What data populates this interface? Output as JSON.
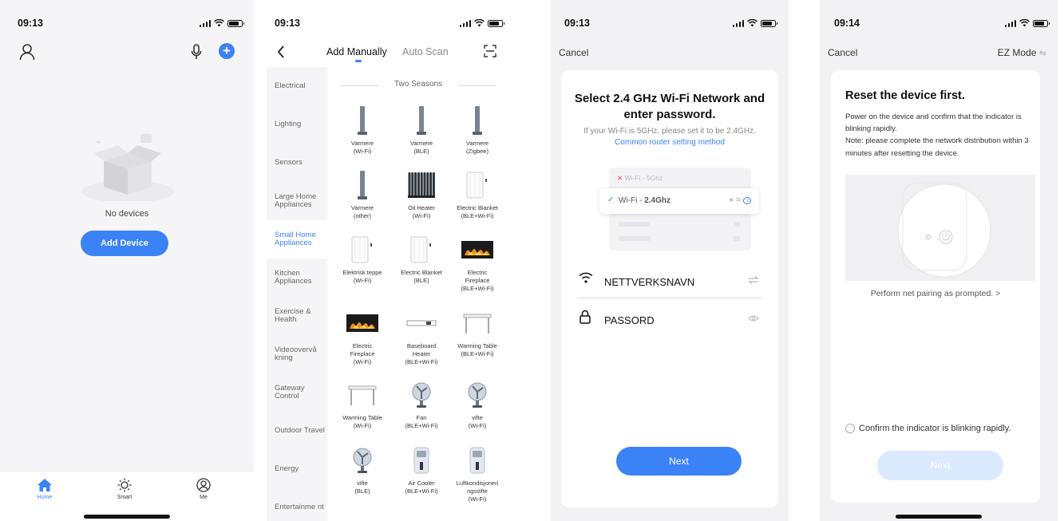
{
  "screens": {
    "home": {
      "time": "09:13",
      "empty_text": "No devices",
      "add_device_label": "Add Device",
      "tabs": [
        {
          "label": "Home",
          "icon": "home-icon",
          "active": true
        },
        {
          "label": "Smart",
          "icon": "sun-icon",
          "active": false
        },
        {
          "label": "Me",
          "icon": "person-icon",
          "active": false
        }
      ]
    },
    "add_device": {
      "time": "09:13",
      "tab_manual": "Add Manually",
      "tab_scan": "Auto Scan",
      "categories": [
        "Electrical",
        "Lighting",
        "Sensors",
        "Large Home Appliances",
        "Small Home Appliances",
        "Kitchen Appliances",
        "Exercise & Health",
        "Videoovervå kning",
        "Gateway Control",
        "Outdoor Travel",
        "Energy",
        "Entertainme nt"
      ],
      "active_category": "Small Home Appliances",
      "group_title": "Two Seasons",
      "products": [
        {
          "name": "Varmere\n(Wi-Fi)",
          "thumb": "tower-heater"
        },
        {
          "name": "Varmere\n(BLE)",
          "thumb": "tower-heater"
        },
        {
          "name": "Varmere\n(Zigbee)",
          "thumb": "tower-heater"
        },
        {
          "name": "Varmere\n(other)",
          "thumb": "tower-heater"
        },
        {
          "name": "Oil Heater\n(Wi-Fi)",
          "thumb": "oil-heater"
        },
        {
          "name": "Electric Blanket\n(BLE+Wi-Fi)",
          "thumb": "blanket"
        },
        {
          "name": "Elektrisk teppe\n(Wi-Fi)",
          "thumb": "blanket"
        },
        {
          "name": "Electric Blanket\n(BLE)",
          "thumb": "blanket"
        },
        {
          "name": "Electric\nFireplace\n(BLE+Wi-Fi)",
          "thumb": "fireplace"
        },
        {
          "name": "Electric\nFireplace\n(Wi-Fi)",
          "thumb": "fireplace"
        },
        {
          "name": "Baseboard\nHeater\n(BLE+Wi-Fi)",
          "thumb": "baseboard"
        },
        {
          "name": "Warming Table\n(BLE+Wi-Fi)",
          "thumb": "table"
        },
        {
          "name": "Warming Table\n(Wi-Fi)",
          "thumb": "table"
        },
        {
          "name": "Fan\n(BLE+Wi-Fi)",
          "thumb": "fan"
        },
        {
          "name": "vifte\n(Wi-Fi)",
          "thumb": "fan"
        },
        {
          "name": "vifte\n(BLE)",
          "thumb": "fan"
        },
        {
          "name": "Air Cooler\n(BLE+Wi-Fi)",
          "thumb": "cooler"
        },
        {
          "name": "Luftkondisjoneri\nngsvifte\n(Wi-Fi)",
          "thumb": "cooler"
        }
      ]
    },
    "wifi": {
      "time": "09:13",
      "cancel": "Cancel",
      "title": "Select 2.4 GHz Wi-Fi Network and enter password.",
      "hint": "If your Wi-Fi is 5GHz, please set it to be 2.4GHz.",
      "hint_link": "Common router setting method",
      "illus_5g": "Wi-Fi - 5Ghz",
      "illus_24_prefix": "Wi-Fi - ",
      "illus_24": "2.4Ghz",
      "ssid": "NETTVERKSNAVN",
      "password": "PASSORD",
      "next": "Next"
    },
    "reset": {
      "time": "09:14",
      "cancel": "Cancel",
      "mode": "EZ Mode",
      "title": "Reset the device first.",
      "desc_1": "Power on the device and confirm that the indicator is blinking rapidly.",
      "desc_2": "Note: please complete the network distribution within 3 minutes after resetting the device.",
      "pairing_link": "Perform net pairing as prompted. >",
      "confirm": "Confirm the indicator is blinking rapidly.",
      "next": "Next"
    }
  },
  "colors": {
    "accent": "#3b82f6",
    "accent_disabled": "#dbeafe"
  }
}
